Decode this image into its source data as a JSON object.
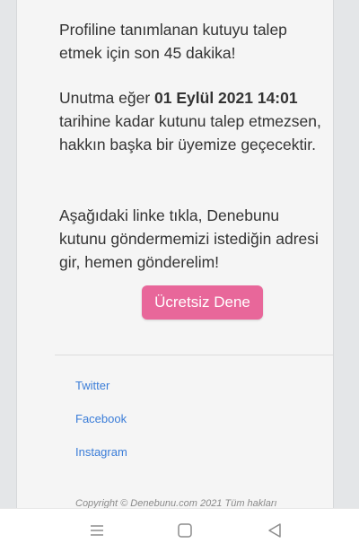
{
  "message": {
    "p1": "Profiline tanımlanan kutuyu talep etmek için son 45 dakika!",
    "p2_before": "Unutma eğer ",
    "p2_bold": "01 Eylül 2021 14:01",
    "p2_after": " tarihine kadar kutunu talep etmezsen, hakkın başka bir üyemize geçecektir.",
    "p3": "Aşağıdaki linke tıkla, Denebunu kutunu göndermemizi istediğin adresi gir, hemen gönderelim!"
  },
  "cta": {
    "label": "Ücretsiz Dene",
    "color": "#e8679a"
  },
  "footer": {
    "links": [
      "Twitter",
      "Facebook",
      "Instagram"
    ],
    "copyright": "Copyright © Denebunu.com 2021 Tüm hakları",
    "link_color": "#3b7dd8"
  },
  "navbar": {
    "icons": [
      "menu-icon",
      "home-square-icon",
      "back-triangle-icon"
    ]
  }
}
